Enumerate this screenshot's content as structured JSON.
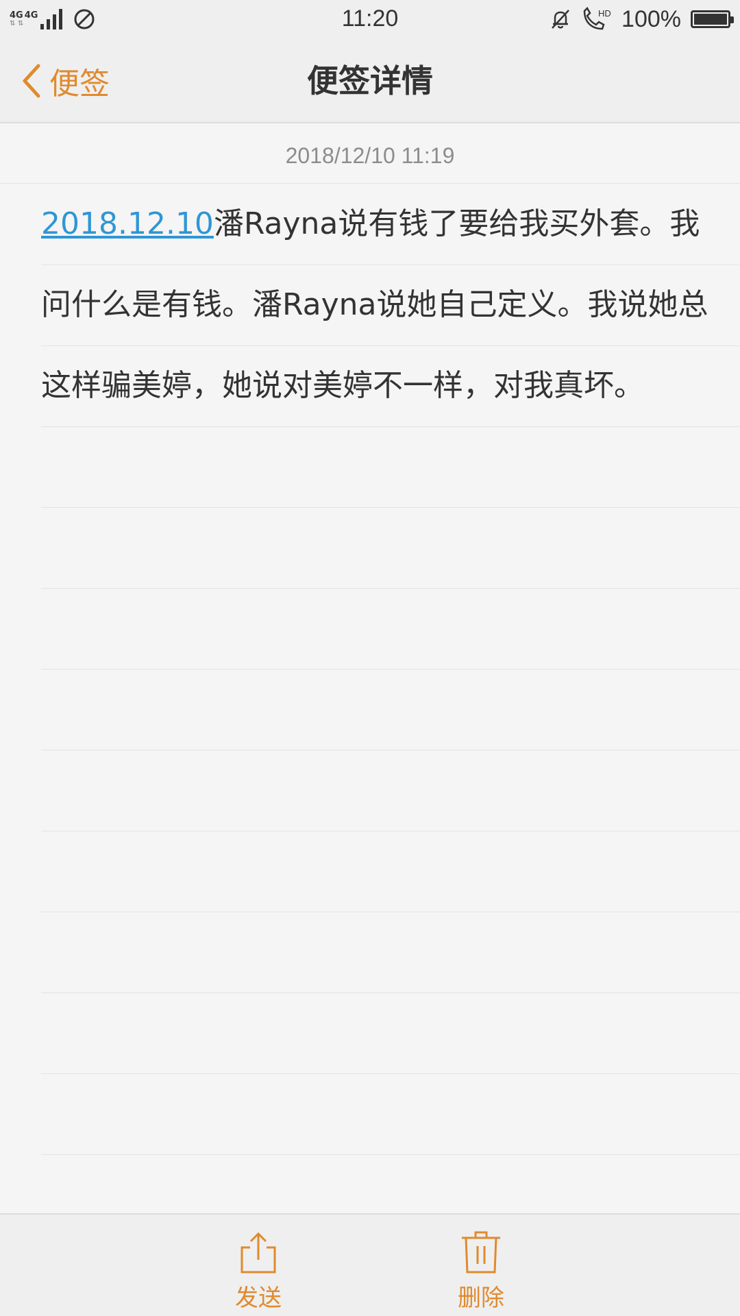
{
  "status_bar": {
    "network_1": "4G",
    "network_2": "4G",
    "time": "11:20",
    "battery_percent": "100%",
    "icons": [
      "signal-icon",
      "do-not-disturb-icon",
      "mute-bell-icon",
      "hd-call-icon",
      "battery-icon"
    ]
  },
  "nav": {
    "back_label": "便签",
    "title": "便签详情"
  },
  "note": {
    "timestamp": "2018/12/10 11:19",
    "link_text": "2018.12.10",
    "body_text": "潘Rayna说有钱了要给我买外套。我问什么是有钱。潘Rayna说她自己定义。我说她总这样骗美婷，她说对美婷不一样，对我真坏。"
  },
  "toolbar": {
    "send_label": "发送",
    "delete_label": "删除"
  },
  "colors": {
    "accent": "#e08a2e",
    "link": "#2f96d4",
    "background": "#f5f5f5",
    "bar": "#efefef"
  }
}
